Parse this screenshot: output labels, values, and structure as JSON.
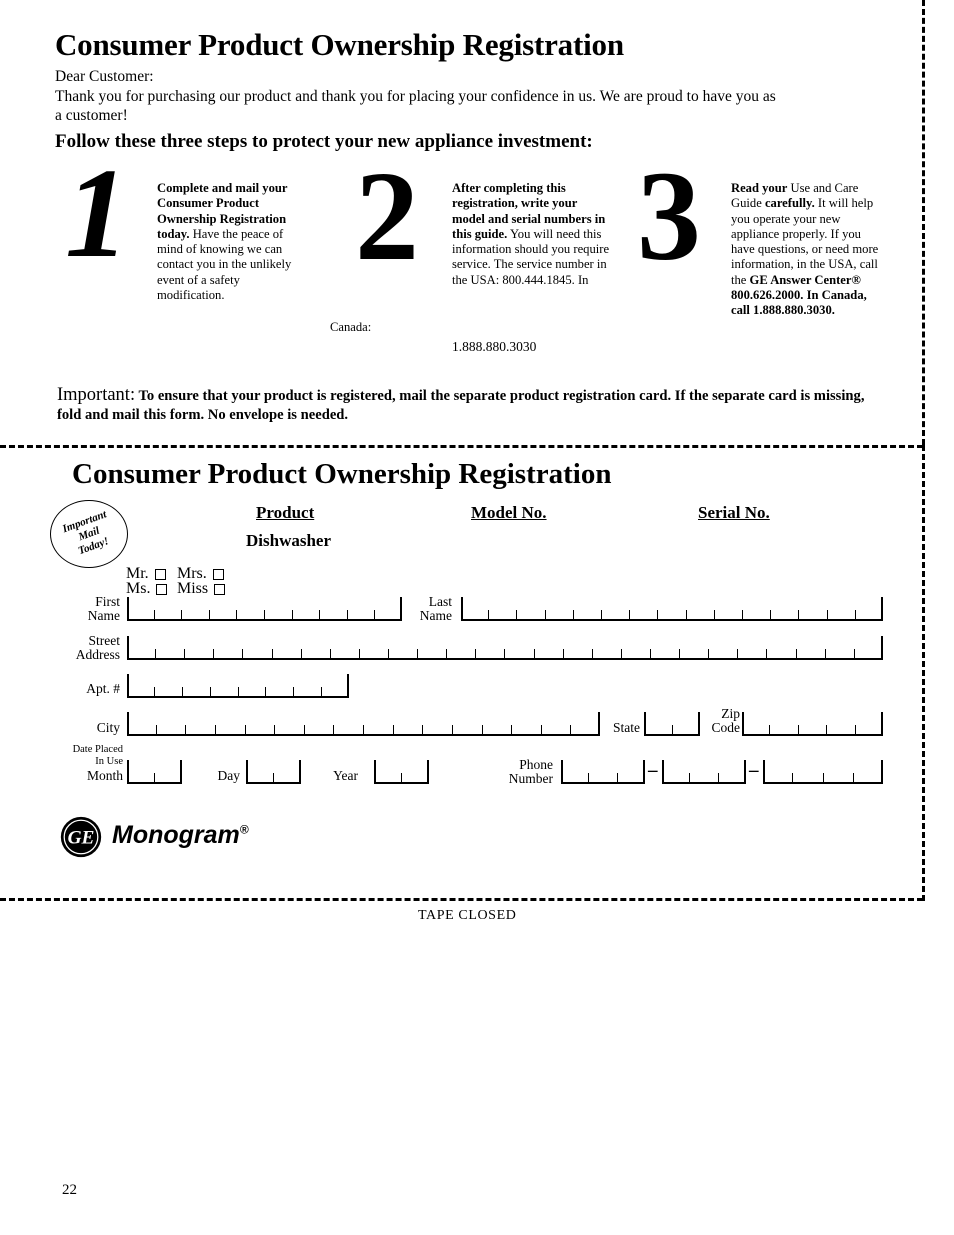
{
  "page": {
    "number": "22",
    "tape_closed": "TAPE CLOSED"
  },
  "letter": {
    "title": "Consumer Product Ownership Registration",
    "salutation": "Dear Customer:",
    "body": "Thank you for purchasing our product and thank you for placing your confidence in us. We are proud to have you as a customer!",
    "follow_heading": "Follow these three steps to protect your new appliance investment:",
    "steps": [
      {
        "number": "1",
        "bold_lead": "Complete and mail your Consumer Product Ownership Registration today.",
        "rest": " Have the peace of mind of knowing we can contact you in the unlikely event of a safety modification."
      },
      {
        "number": "2",
        "bold_lead": "After completing this registration, write your model and serial numbers in this guide.",
        "rest": " You will need this information should you require service. The service number in the USA: 800.444.1845. In",
        "canada_label": "Canada:",
        "canada_number": "1.888.880.3030"
      },
      {
        "number": "3",
        "bold_lead": "Read your",
        "mid1": " Use and Care Guide ",
        "bold_mid": "carefully.",
        "mid2": " It will help you operate your new appliance properly. If you have questions, or need more information, in the USA, call the ",
        "bold_tail": "GE Answer Center® 800.626.2000. In Canada, call 1.888.880.3030."
      }
    ],
    "important_lead": "Important:",
    "important_text": " To ensure that your product is registered, mail the separate product registration card. If the separate card is missing, fold and mail this form. No envelope is needed."
  },
  "card": {
    "title": "Consumer Product Ownership Registration",
    "stamp": {
      "line1": "Important",
      "line2": "Mail",
      "line3": "Today!"
    },
    "columns": {
      "product_header": "Product",
      "product_value": "Dishwasher",
      "model_header": "Model No.",
      "serial_header": "Serial No."
    },
    "title_options": [
      {
        "label": "Mr."
      },
      {
        "label": "Mrs."
      },
      {
        "label": "Ms."
      },
      {
        "label": "Miss"
      }
    ],
    "fields": {
      "first_name": {
        "label_line1": "First",
        "label_line2": "Name",
        "cells": 10
      },
      "last_name": {
        "label_line1": "Last",
        "label_line2": "Name",
        "cells": 15
      },
      "street": {
        "label_line1": "Street",
        "label_line2": "Address",
        "cells": 26
      },
      "apt": {
        "label_line1": "Apt. #",
        "label_line2": "",
        "cells": 8
      },
      "city": {
        "label_line1": "City",
        "label_line2": "",
        "cells": 16
      },
      "state": {
        "label_line1": "State",
        "label_line2": "",
        "cells": 2
      },
      "zip": {
        "label_line1": "Zip",
        "label_line2": "Code",
        "cells": 5
      },
      "date_placed": {
        "label_line1": "Date Placed",
        "label_line2": "In Use",
        "label_line3": "Month",
        "cells": 2
      },
      "day": {
        "label_line1": "Day",
        "cells": 2
      },
      "year": {
        "label_line1": "Year",
        "cells": 2
      },
      "phone": {
        "label_line1": "Phone",
        "label_line2": "Number",
        "cells_area": 3,
        "cells_prefix": 3,
        "cells_line": 4,
        "separator": "–"
      }
    },
    "logo": {
      "mark": "ge-monogram-mark",
      "wordmark": "Monogram",
      "registered": "®"
    }
  }
}
